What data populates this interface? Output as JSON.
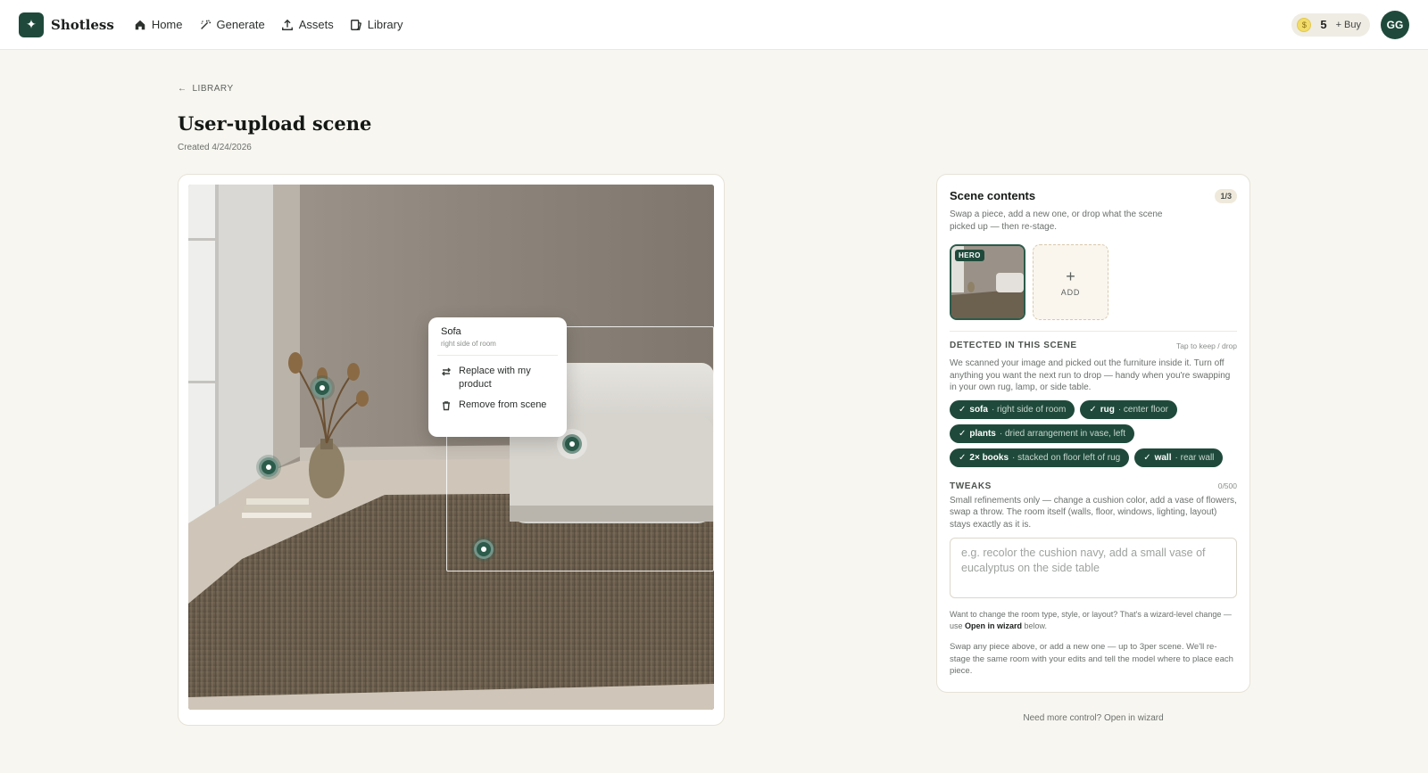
{
  "app": {
    "brand": "Shotless",
    "logo_glyph": "✦"
  },
  "nav": {
    "items": [
      {
        "label": "Home",
        "icon": "home-icon"
      },
      {
        "label": "Generate",
        "icon": "wand-icon"
      },
      {
        "label": "Assets",
        "icon": "upload-icon"
      },
      {
        "label": "Library",
        "icon": "library-icon"
      }
    ]
  },
  "account": {
    "credits": "5",
    "buy_label": "+ Buy",
    "avatar_initials": "GG"
  },
  "header": {
    "back_label": "LIBRARY",
    "title": "User-upload scene",
    "created": "Created 4/24/2026"
  },
  "popover": {
    "title": "Sofa",
    "subtitle": "right side of room",
    "replace_label": "Replace with my product",
    "remove_label": "Remove from scene"
  },
  "panel": {
    "title": "Scene contents",
    "count_badge": "1/3",
    "description": "Swap a piece, add a new one, or drop what the scene picked up — then re-stage.",
    "hero_tag": "HERO",
    "add_label": "ADD",
    "detected_title": "DETECTED IN THIS SCENE",
    "detected_hint": "Tap to keep / drop",
    "detected_desc": "We scanned your image and picked out the furniture inside it. Turn off anything you want the next run to drop — handy when you're swapping in your own rug, lamp, or side table.",
    "chips": [
      {
        "name": "sofa",
        "desc": "· right side of room"
      },
      {
        "name": "rug",
        "desc": "· center floor"
      },
      {
        "name": "plants",
        "desc": "· dried arrangement in vase, left"
      },
      {
        "name": "2× books",
        "desc": "· stacked on floor left of rug"
      },
      {
        "name": "wall",
        "desc": "· rear wall"
      }
    ],
    "tweaks_title": "TWEAKS",
    "tweaks_count": "0/500",
    "tweaks_desc": "Small refinements only — change a cushion color, add a vase of flowers, swap a throw. The room itself (walls, floor, windows, lighting, layout) stays exactly as it is.",
    "tweaks_placeholder": "e.g. recolor the cushion navy, add a small vase of eucalyptus on the side table",
    "note_before": "Want to change the room type, style, or layout? That's a wizard-level change — use ",
    "note_bold": "Open in wizard",
    "note_after": " below.",
    "note2": "Swap any piece above, or add a new one — up to 3per scene. We'll re-stage the same room with your edits and tell the model where to place each piece."
  },
  "footer": {
    "wizard_link": "Need more control? Open in wizard"
  },
  "colors": {
    "brand_green": "#1f4a3b",
    "pin_green": "#2c5b4b",
    "background": "#f8f6f0"
  }
}
